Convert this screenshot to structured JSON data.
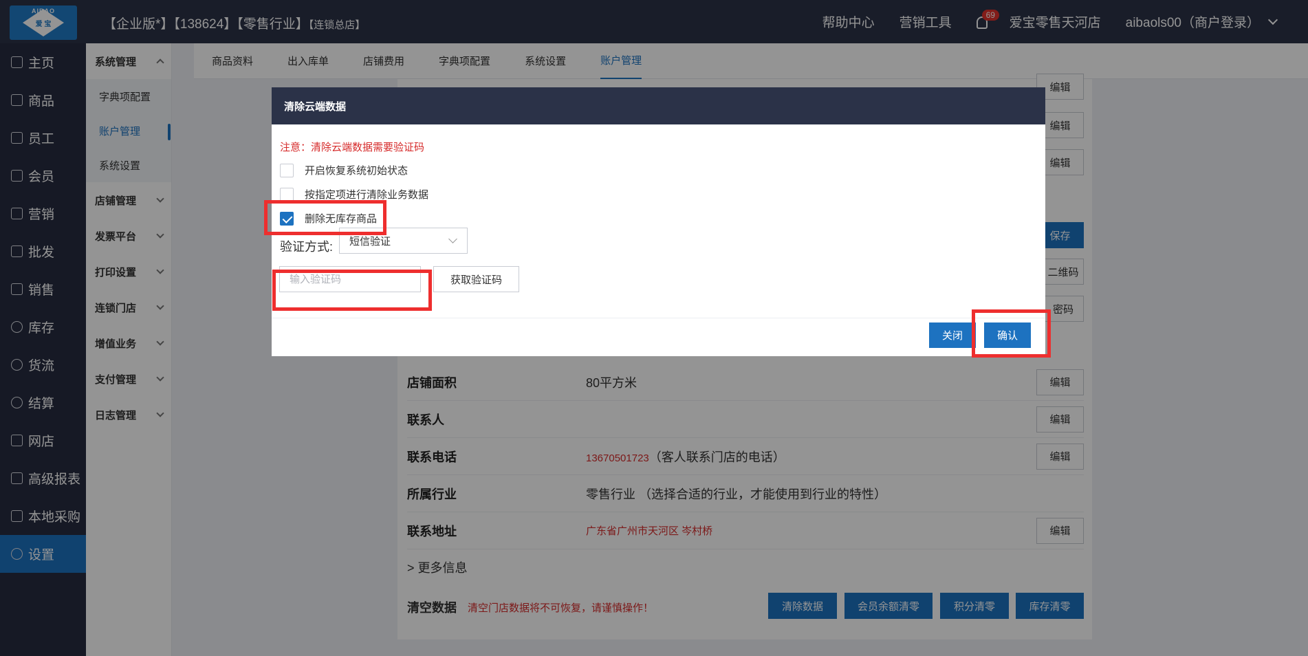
{
  "topbar": {
    "logo_text": "AIBAO",
    "logo_sub": "爱 宝",
    "title_main": "【企业版*】【138624】【零售行业】",
    "title_sub": "【连锁总店】",
    "help": "帮助中心",
    "marketing_tools": "营销工具",
    "notification_count": "69",
    "store_name": "爱宝零售天河店",
    "user": "aibaols00（商户登录）"
  },
  "leftnav": {
    "items": [
      {
        "label": "主页",
        "icon": "home-icon"
      },
      {
        "label": "商品",
        "icon": "goods-icon"
      },
      {
        "label": "员工",
        "icon": "staff-icon"
      },
      {
        "label": "会员",
        "icon": "member-icon"
      },
      {
        "label": "营销",
        "icon": "megaphone-icon"
      },
      {
        "label": "批发",
        "icon": "wholesale-icon"
      },
      {
        "label": "销售",
        "icon": "sales-chart-icon"
      },
      {
        "label": "库存",
        "icon": "inventory-icon"
      },
      {
        "label": "货流",
        "icon": "logistics-icon"
      },
      {
        "label": "结算",
        "icon": "settlement-icon"
      },
      {
        "label": "网店",
        "icon": "shop-icon"
      },
      {
        "label": "高级报表",
        "icon": "report-icon"
      },
      {
        "label": "本地采购",
        "icon": "purchase-icon"
      },
      {
        "label": "设置",
        "icon": "gear-icon"
      }
    ],
    "active": "设置"
  },
  "subnav": {
    "system_group": "系统管理",
    "children": [
      "字典项配置",
      "账户管理",
      "系统设置"
    ],
    "groups": [
      "店铺管理",
      "发票平台",
      "打印设置",
      "连锁门店",
      "增值业务",
      "支付管理",
      "日志管理"
    ]
  },
  "tabs": [
    "商品资料",
    "出入库单",
    "店铺费用",
    "字典项配置",
    "系统设置",
    "账户管理"
  ],
  "active_tab": "账户管理",
  "background": {
    "edit_label": "编辑",
    "save_label": "保存",
    "peek_qrcode": "二维码",
    "peek_password": "密码",
    "rows": {
      "area": {
        "label": "店铺面积",
        "value": "80平方米"
      },
      "contact": {
        "label": "联系人",
        "value": ""
      },
      "phone": {
        "label": "联系电话",
        "number": "13670501723",
        "note": "（客人联系门店的电话）"
      },
      "industry": {
        "label": "所属行业",
        "value": "零售行业 （选择合适的行业，才能使用到行业的特性）"
      },
      "address": {
        "label": "联系地址",
        "value": "广东省广州市天河区 岑村桥"
      }
    },
    "more_info": "> 更多信息",
    "clear": {
      "label": "清空数据",
      "warning": "清空门店数据将不可恢复，请谨慎操作！",
      "buttons": [
        "清除数据",
        "会员余额清零",
        "积分清零",
        "库存清零"
      ]
    }
  },
  "dialog": {
    "title": "清除云端数据",
    "notice": "注意：清除云端数据需要验证码",
    "options": [
      {
        "label": "开启恢复系统初始状态",
        "checked": false
      },
      {
        "label": "按指定项进行清除业务数据",
        "checked": false
      },
      {
        "label": "删除无库存商品",
        "checked": true
      }
    ],
    "verify_label": "验证方式:",
    "verify_method": "短信验证",
    "code_placeholder": "输入验证码",
    "get_code": "获取验证码",
    "close": "关闭",
    "confirm": "确认"
  },
  "colors": {
    "primary": "#1d72c0",
    "topbar": "#2b3248",
    "highlight": "#ee2e2e",
    "warning_text": "#d62b2b"
  }
}
